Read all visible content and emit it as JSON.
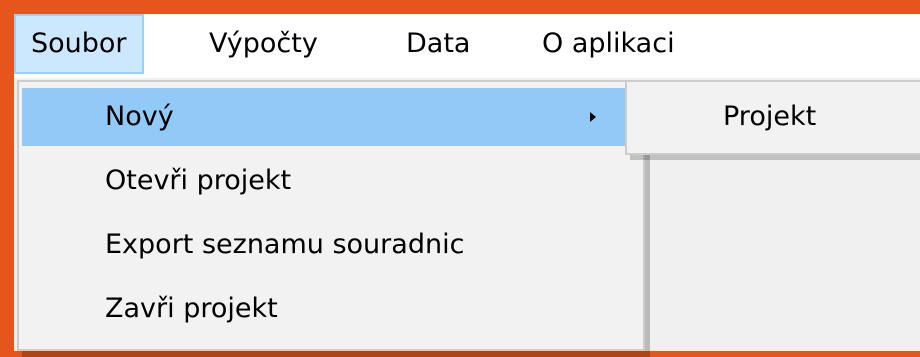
{
  "colors": {
    "frame": "#e5561c",
    "menubar_bg": "#ffffff",
    "menubar_active_bg": "#cce8ff",
    "menubar_active_border": "#99d1ff",
    "menu_bg": "#f2f2f2",
    "menu_highlight": "#91c9f7"
  },
  "menubar": {
    "items": [
      {
        "label": "Soubor",
        "active": true
      },
      {
        "label": "Výpočty",
        "active": false
      },
      {
        "label": "Data",
        "active": false
      },
      {
        "label": "O aplikaci",
        "active": false
      }
    ]
  },
  "menu": {
    "items": [
      {
        "label": "Nový",
        "highlighted": true,
        "has_submenu": true,
        "icon": "chevron-right-icon"
      },
      {
        "label": "Otevři projekt",
        "highlighted": false,
        "has_submenu": false
      },
      {
        "label": "Export seznamu souradnic",
        "highlighted": false,
        "has_submenu": false
      },
      {
        "label": "Zavři projekt",
        "highlighted": false,
        "has_submenu": false
      }
    ]
  },
  "submenu": {
    "items": [
      {
        "label": "Projekt"
      }
    ]
  }
}
